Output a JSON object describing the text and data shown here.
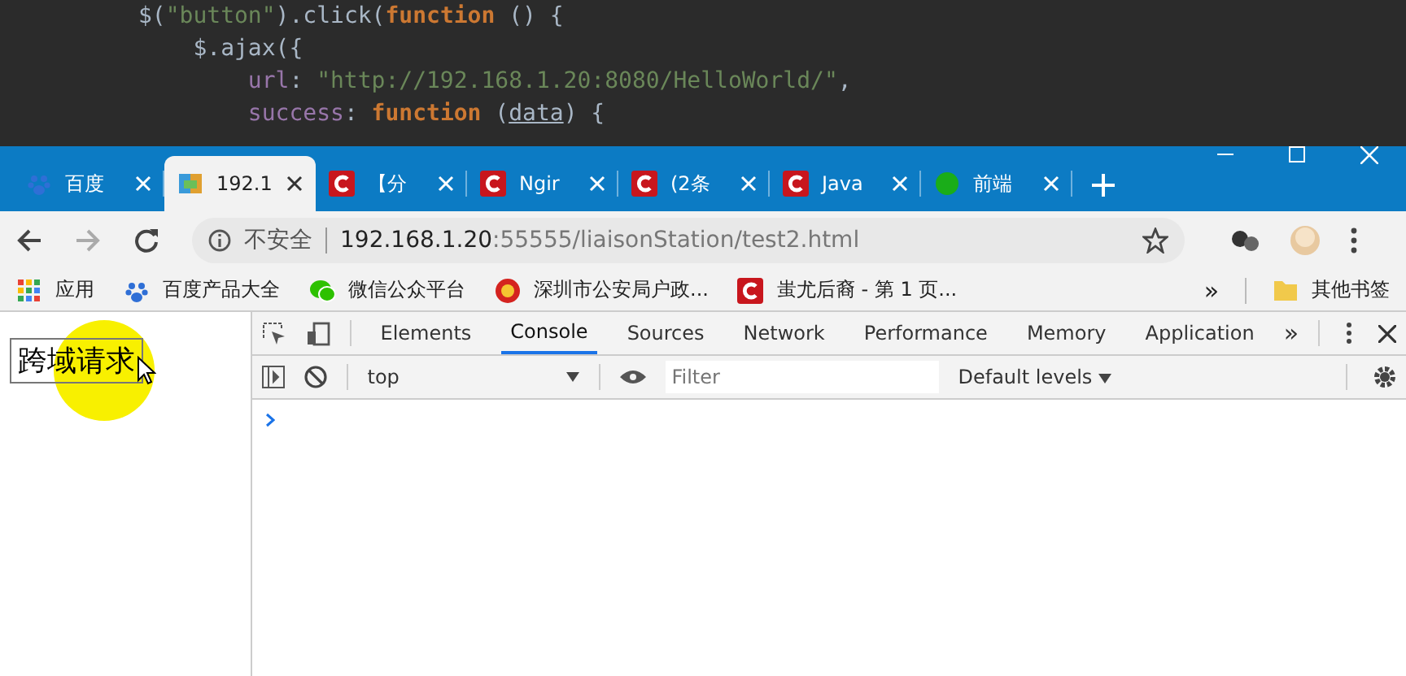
{
  "code_editor": {
    "lines": [
      [
        {
          "text": "$(",
          "kind": "plain"
        },
        {
          "text": "\"button\"",
          "kind": "string"
        },
        {
          "text": ").click(",
          "kind": "plain"
        },
        {
          "text": "function",
          "kind": "keyword"
        },
        {
          "text": " () {",
          "kind": "plain"
        }
      ],
      [
        {
          "text": "    $.ajax({",
          "kind": "plain"
        }
      ],
      [
        {
          "text": "        url",
          "kind": "property"
        },
        {
          "text": ": ",
          "kind": "plain"
        },
        {
          "text": "\"http://192.168.1.20:8080/HelloWorld/\"",
          "kind": "string"
        },
        {
          "text": ",",
          "kind": "plain"
        }
      ],
      [
        {
          "text": "        success",
          "kind": "property"
        },
        {
          "text": ": ",
          "kind": "plain"
        },
        {
          "text": "function",
          "kind": "keyword"
        },
        {
          "text": " (",
          "kind": "plain"
        },
        {
          "text": "data",
          "kind": "param"
        },
        {
          "text": ") {",
          "kind": "plain"
        }
      ]
    ]
  },
  "browser": {
    "tabs": [
      {
        "label": "百度",
        "kind": "paw",
        "selected": false
      },
      {
        "label": "192.1",
        "kind": "cube",
        "selected": true
      },
      {
        "label": "【分",
        "kind": "clogo",
        "selected": false
      },
      {
        "label": "Ngir",
        "kind": "clogo",
        "selected": false
      },
      {
        "label": "(2条",
        "kind": "clogo",
        "selected": false
      },
      {
        "label": "Java",
        "kind": "clogo",
        "selected": false
      },
      {
        "label": "前端",
        "kind": "dot",
        "selected": false
      }
    ],
    "address_bar": {
      "security": "不安全",
      "host": "192.168.1.20",
      "path": ":55555/liaisonStation/test2.html"
    },
    "bookmarks": [
      {
        "label": "应用",
        "kind": "grid"
      },
      {
        "label": "百度产品大全",
        "kind": "paw"
      },
      {
        "label": "微信公众平台",
        "kind": "chat"
      },
      {
        "label": "深圳市公安局户政...",
        "kind": "badge"
      },
      {
        "label": "蚩尤后裔 - 第 1 页...",
        "kind": "clogo"
      }
    ],
    "bookmarks_more": "»",
    "other_bookmarks": "其他书签"
  },
  "page": {
    "button": "跨域请求"
  },
  "devtools": {
    "tabs": [
      {
        "label": "Elements",
        "selected": false
      },
      {
        "label": "Console",
        "selected": true
      },
      {
        "label": "Sources",
        "selected": false
      },
      {
        "label": "Network",
        "selected": false
      },
      {
        "label": "Performance",
        "selected": false
      },
      {
        "label": "Memory",
        "selected": false
      },
      {
        "label": "Application",
        "selected": false
      }
    ],
    "more_tabs": "»",
    "context": "top",
    "filter": {
      "placeholder": "Filter"
    },
    "levels": "Default levels"
  }
}
